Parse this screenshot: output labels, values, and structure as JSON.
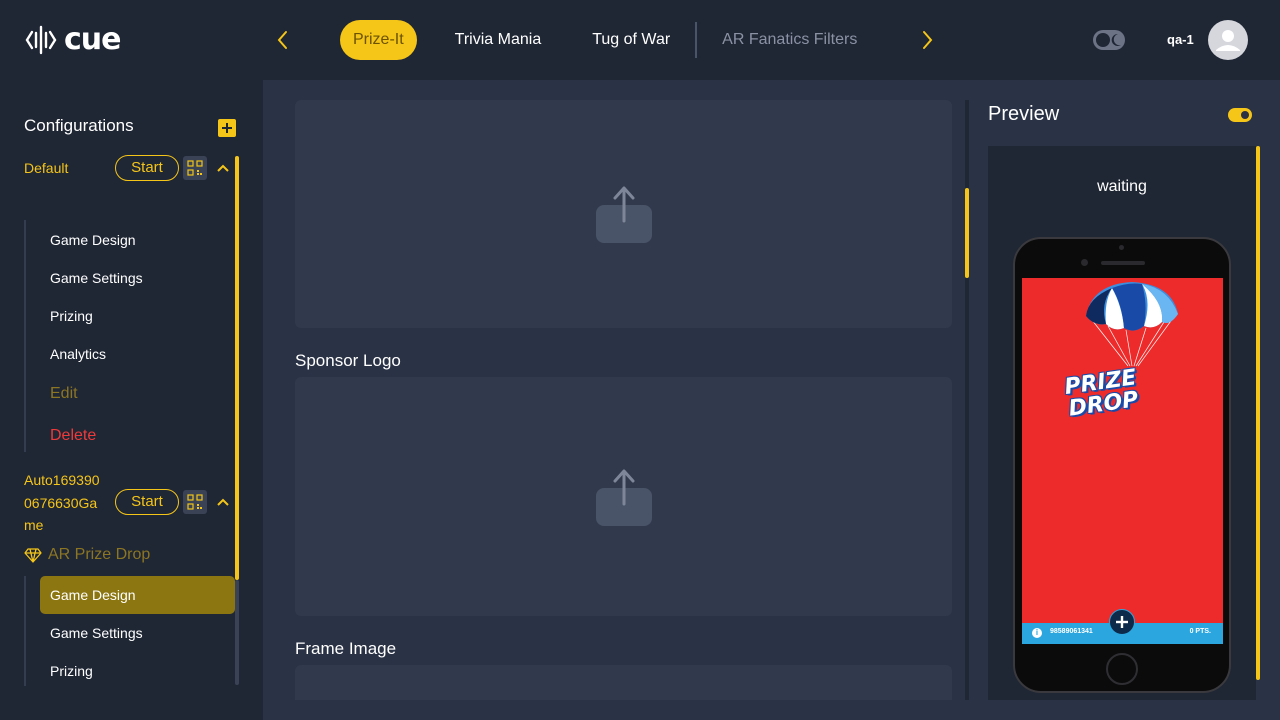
{
  "app": {
    "logo_text": "cue",
    "user": "qa-1"
  },
  "nav": {
    "tabs": [
      {
        "label": "Prize-It",
        "state": "active"
      },
      {
        "label": "Trivia Mania",
        "state": "normal"
      },
      {
        "label": "Tug of War",
        "state": "normal"
      },
      {
        "label": "AR Fanatics Filters",
        "state": "dim"
      }
    ]
  },
  "sidebar": {
    "title": "Configurations",
    "configs": [
      {
        "name": "Default",
        "start_label": "Start",
        "menu": [
          "Game Design",
          "Game Settings",
          "Prizing",
          "Analytics"
        ],
        "edit_label": "Edit",
        "delete_label": "Delete"
      },
      {
        "name_lines": [
          "Auto169390",
          "0676630Ga",
          "me"
        ],
        "start_label": "Start",
        "game_type": "AR Prize Drop",
        "menu": [
          "Game Design",
          "Game Settings",
          "Prizing"
        ],
        "selected": "Game Design"
      }
    ]
  },
  "editor": {
    "sections": [
      {
        "label": ""
      },
      {
        "label": "Sponsor Logo"
      },
      {
        "label": "Frame Image"
      }
    ]
  },
  "preview": {
    "title": "Preview",
    "status": "waiting",
    "phone": {
      "logo_line1": "PRIZE",
      "logo_line2": "DROP",
      "player_id": "98589061341",
      "points": "0 PTS."
    }
  },
  "colors": {
    "accent": "#f5c518",
    "background": "#1f2634",
    "panel": "#2a3245",
    "upload_box": "#313a4d",
    "danger": "#ee3a3a",
    "screen_red": "#ee2b2b",
    "bar_blue": "#2ba6df"
  }
}
